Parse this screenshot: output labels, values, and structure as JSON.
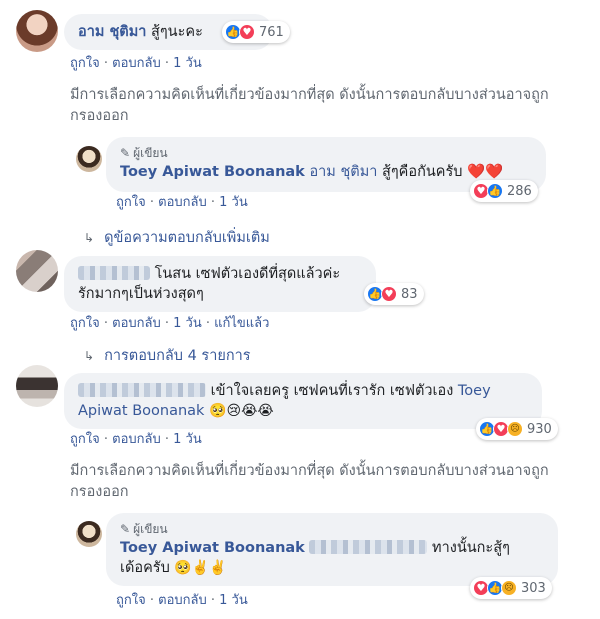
{
  "comments": [
    {
      "name": "อาม ชุติมา",
      "text": "สู้ๆนะคะ",
      "reaction_count": "761",
      "actions": [
        "ถูกใจ",
        "ตอบกลับ",
        "1 วัน"
      ]
    },
    {
      "filter_note": "มีการเลือกความคิดเห็นที่เกี่ยวข้องมากที่สุด ดังนั้นการตอบกลับบางส่วนอาจถูกกรองออก"
    },
    {
      "author_tag": "ผู้เขียน",
      "name": "Toey Apiwat Boonanak",
      "mention": "อาม ชุติมา",
      "text": "สู้ๆคือกันครับ",
      "reaction_count": "286",
      "actions": [
        "ถูกใจ",
        "ตอบกลับ",
        "1 วัน"
      ]
    },
    {
      "more_replies": "ดูข้อความตอบกลับเพิ่มเติม"
    },
    {
      "text_line1": "โนสน เซฟตัวเองดีที่สุดแล้วค่ะ",
      "text_line2": "รักมากๆเป็นห่วงสุดๆ",
      "reaction_count": "83",
      "actions": [
        "ถูกใจ",
        "ตอบกลับ",
        "1 วัน",
        "แก้ไขแล้ว"
      ]
    },
    {
      "more_replies": "การตอบกลับ 4 รายการ"
    },
    {
      "text_line1": "เข้าใจเลยครู เซฟคนที่เรารัก เซฟตัวเอง",
      "mention_part1": "Toey",
      "mention_part2": "Apiwat Boonanak",
      "reaction_count": "930",
      "actions": [
        "ถูกใจ",
        "ตอบกลับ",
        "1 วัน"
      ]
    },
    {
      "filter_note": "มีการเลือกความคิดเห็นที่เกี่ยวข้องมากที่สุด ดังนั้นการตอบกลับบางส่วนอาจถูกกรองออก"
    },
    {
      "author_tag": "ผู้เขียน",
      "name": "Toey Apiwat Boonanak",
      "text_line1": "ทางนั้นกะสู้ๆ",
      "text_line2": "เด้อครับ",
      "reaction_count": "303",
      "actions": [
        "ถูกใจ",
        "ตอบกลับ",
        "1 วัน"
      ]
    }
  ],
  "icons": {
    "like": "like-icon",
    "love": "love-icon",
    "sad": "sad-icon",
    "pen": "pen-icon",
    "reply_arrow": "reply-arrow-icon"
  },
  "colors": {
    "link": "#385898",
    "bubble": "#f0f2f5",
    "meta": "#606770",
    "like": "#1877f2",
    "love": "#f33e58"
  }
}
